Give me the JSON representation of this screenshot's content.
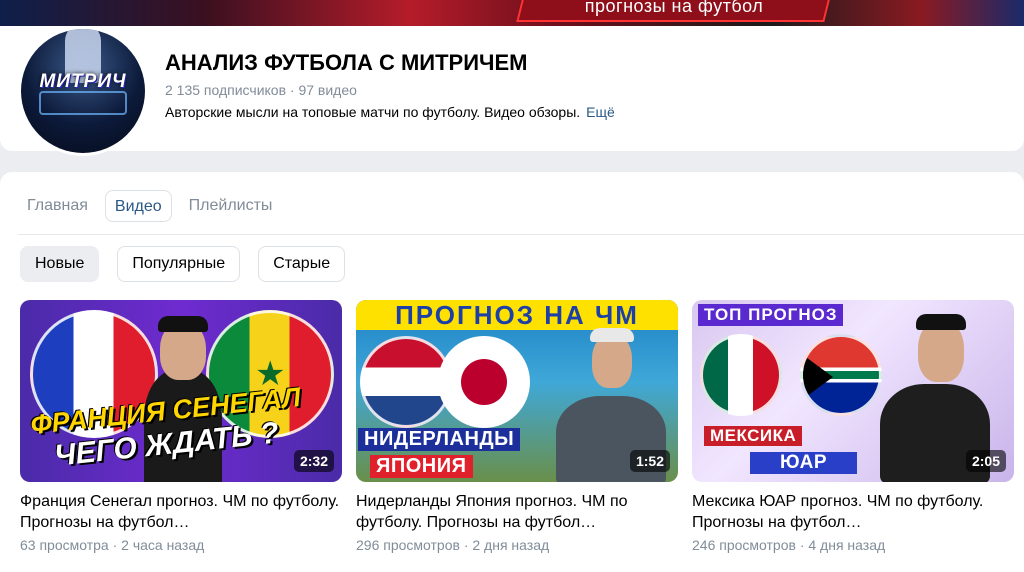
{
  "cover": {
    "banner_text": "прогнозы на футбол"
  },
  "channel": {
    "avatar_text": "МИТРИЧ",
    "title": "АНАЛИЗ ФУТБОЛА С МИТРИЧЕМ",
    "meta": "2 135 подписчиков · 97 видео",
    "description": "Авторские мысли на топовые матчи по футболу. Видео обзоры.",
    "more_label": "Ещё"
  },
  "tabs": [
    {
      "label": "Главная",
      "active": false
    },
    {
      "label": "Видео",
      "active": true
    },
    {
      "label": "Плейлисты",
      "active": false
    }
  ],
  "filters": [
    {
      "label": "Новые",
      "active": true
    },
    {
      "label": "Популярные",
      "active": false
    },
    {
      "label": "Старые",
      "active": false
    }
  ],
  "videos": [
    {
      "title": "Франция Сенегал прогноз. ЧМ по футболу. Прогнозы на футбол…",
      "meta": "63 просмотра · 2 часа назад",
      "duration": "2:32",
      "thumb_line1": "ФРАНЦИЯ СЕНЕГАЛ",
      "thumb_line2": "ЧЕГО ЖДАТЬ ?"
    },
    {
      "title": "Нидерланды Япония прогноз. ЧМ по футболу. Прогнозы на футбол…",
      "meta": "296 просмотров · 2 дня назад",
      "duration": "1:52",
      "thumb_header": "ПРОГНОЗ НА ЧМ",
      "thumb_line1": "НИДЕРЛАНДЫ",
      "thumb_line2": "ЯПОНИЯ"
    },
    {
      "title": "Мексика ЮАР прогноз. ЧМ по футболу. Прогнозы на футбол…",
      "meta": "246 просмотров · 4 дня назад",
      "duration": "2:05",
      "thumb_header": "ТОП ПРОГНОЗ",
      "thumb_line1": "МЕКСИКА",
      "thumb_line2": "ЮАР"
    }
  ],
  "colors": {
    "link": "#2a5885",
    "muted": "#818c99",
    "page_bg": "#ebedf0"
  }
}
